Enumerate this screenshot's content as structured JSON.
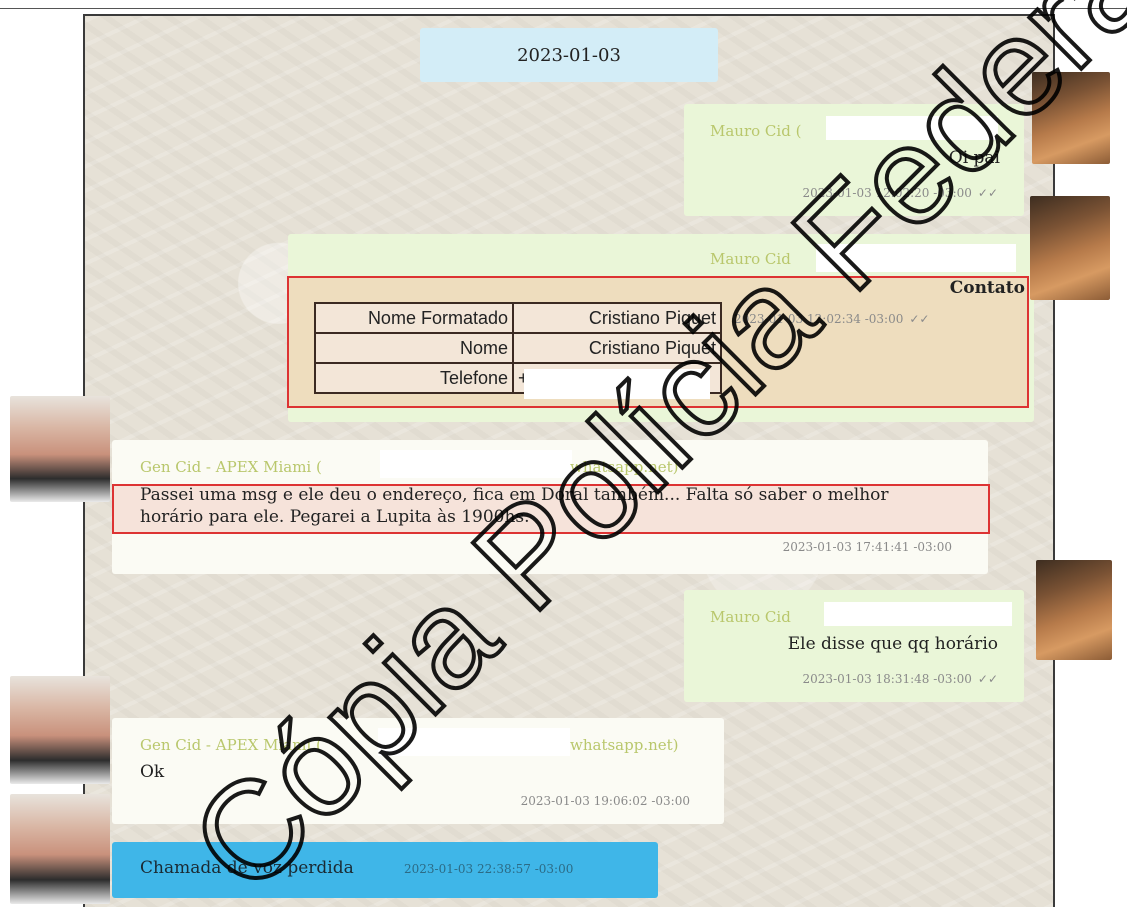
{
  "date_chip": "2023-01-03",
  "messages": [
    {
      "sender": "Mauro Cid (",
      "text": "Oi pai",
      "time": "2023-01-03 12:02:20 -03:00",
      "ticks": "✓✓"
    },
    {
      "sender": "Mauro Cid",
      "text": "Contato",
      "time": "2023-01-03 12:02:34 -03:00",
      "ticks": "✓✓",
      "contact": {
        "rows": [
          {
            "label": "Nome Formatado",
            "value": "Cristiano Piquet"
          },
          {
            "label": "Nome",
            "value": "Cristiano Piquet"
          },
          {
            "label": "Telefone",
            "value": "+"
          }
        ]
      }
    },
    {
      "sender": "Gen Cid - APEX Miami (",
      "sender_suffix": "whatsapp.net)",
      "text": "Passei uma msg e ele deu o endereço, fica em Doral também... Falta só saber o melhor horário para ele. Pegarei a Lupita às 1900hs.",
      "time": "2023-01-03 17:41:41 -03:00"
    },
    {
      "sender": "Mauro Cid",
      "text": "Ele disse que qq horário",
      "time": "2023-01-03 18:31:48 -03:00",
      "ticks": "✓✓"
    },
    {
      "sender": "Gen Cid - APEX Miami (",
      "sender_suffix": "whatsapp.net)",
      "text": "Ok",
      "time": "2023-01-03 19:06:02 -03:00"
    },
    {
      "text": "Chamada de voz perdida",
      "time": "2023-01-03 22:38:57 -03:00"
    }
  ],
  "watermark": "Cópia Polícia Federal",
  "colors": {
    "sender": "#b9c76c",
    "outgoing_bg": "#eaf6d8",
    "incoming_bg": "#fbfbf4",
    "call_bg": "#3fb6e8",
    "highlight": "#d33333"
  }
}
